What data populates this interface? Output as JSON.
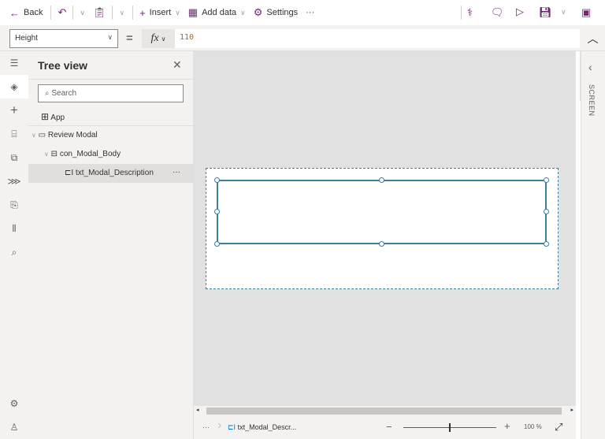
{
  "toolbar": {
    "back": "Back",
    "insert": "Insert",
    "add_data": "Add data",
    "settings": "Settings",
    "more": "···"
  },
  "formula": {
    "property": "Height",
    "equals": "=",
    "fx": "fx",
    "value": "110"
  },
  "tree": {
    "title": "Tree view",
    "search_placeholder": "Search",
    "app": "App",
    "screen": "Review Modal",
    "container": "con_Modal_Body",
    "selected": "txt_Modal_Description",
    "more": "···"
  },
  "right_panel": {
    "label": "SCREEN"
  },
  "status": {
    "more": "···",
    "breadcrumb": "txt_Modal_Descr...",
    "zoom": "100 %",
    "zoom_fraction": 0.5
  },
  "colors": {
    "accent": "#742774",
    "selection": "#3d7f9a"
  }
}
